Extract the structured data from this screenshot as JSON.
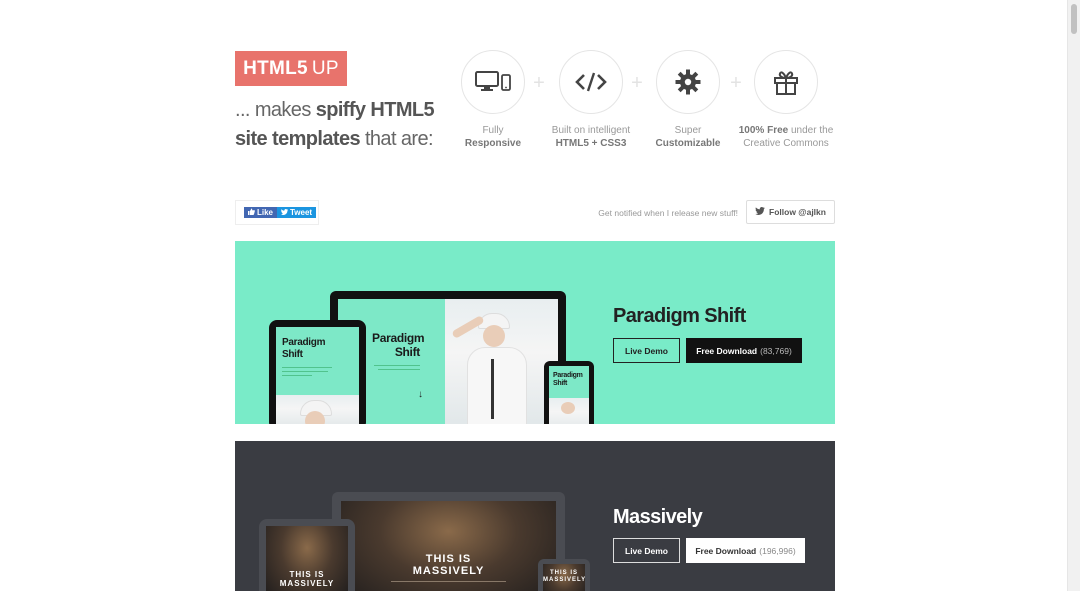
{
  "header": {
    "logo_main": "HTML5",
    "logo_up": "UP",
    "tagline_a": "... makes ",
    "tagline_b": "spiffy HTML5",
    "tagline_c": "site templates",
    "tagline_d": " that are:"
  },
  "features": [
    {
      "icon": "devices-icon",
      "line1": "Fully",
      "line2": "Responsive"
    },
    {
      "icon": "code-icon",
      "line1": "Built on intelligent",
      "line2": "HTML5 + CSS3"
    },
    {
      "icon": "gear-icon",
      "line1": "Super",
      "line2": "Customizable"
    },
    {
      "icon": "gift-icon",
      "line1_bold": "100% Free",
      "line1_rest": " under the",
      "line2": "Creative Commons"
    }
  ],
  "social": {
    "like_label": "Like",
    "tweet_label": "Tweet",
    "notify_text": "Get notified when I release new stuff!",
    "follow_label": "Follow @ajlkn"
  },
  "templates": [
    {
      "title": "Paradigm Shift",
      "demo_label": "Live Demo",
      "download_label": "Free Download",
      "download_count": "(83,769)",
      "bg": "#79ebc8",
      "screen_title_line1": "Paradigm",
      "screen_title_line2": "Shift"
    },
    {
      "title": "Massively",
      "demo_label": "Live Demo",
      "download_label": "Free Download",
      "download_count": "(196,996)",
      "bg": "#3a3c42",
      "screen_title_line1": "THIS IS",
      "screen_title_line2": "MASSIVELY"
    }
  ],
  "colors": {
    "accent": "#e8736c",
    "facebook": "#4267b2",
    "twitter": "#1b95e0"
  }
}
